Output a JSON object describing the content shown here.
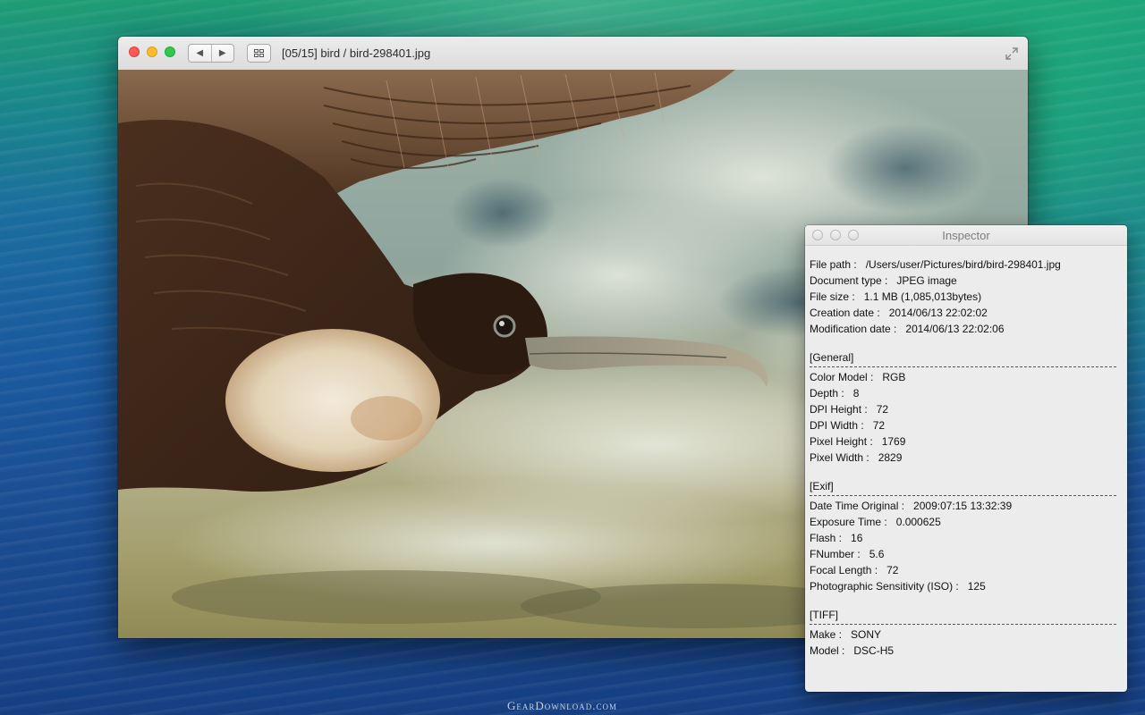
{
  "desktop": {
    "watermark": "GearDownload.com",
    "colors": {
      "wave_top": "#1f9d74",
      "wave_bottom": "#163f82"
    }
  },
  "viewer": {
    "title": "[05/15] bird / bird-298401.jpg",
    "nav": {
      "back_icon": "triangle-left-icon",
      "back_glyph": "◀",
      "forward_icon": "triangle-right-icon",
      "forward_glyph": "▶"
    },
    "grid_icon": "thumbnail-grid-icon",
    "fullscreen_icon": "fullscreen-expand-icon",
    "image_subject": "bird"
  },
  "inspector": {
    "title": "Inspector",
    "file": [
      {
        "key": "File path :",
        "value": "/Users/user/Pictures/bird/bird-298401.jpg"
      },
      {
        "key": "Document type :",
        "value": "JPEG image"
      },
      {
        "key": "File size :",
        "value": "1.1 MB (1,085,013bytes)"
      },
      {
        "key": "Creation date :",
        "value": "2014/06/13 22:02:02"
      },
      {
        "key": "Modification date :",
        "value": "2014/06/13 22:02:06"
      }
    ],
    "general": {
      "header": "[General]",
      "rows": [
        {
          "key": "Color Model :",
          "value": "RGB"
        },
        {
          "key": "Depth :",
          "value": "8"
        },
        {
          "key": "DPI Height :",
          "value": "72"
        },
        {
          "key": "DPI Width :",
          "value": "72"
        },
        {
          "key": "Pixel Height :",
          "value": "1769"
        },
        {
          "key": "Pixel Width :",
          "value": "2829"
        }
      ]
    },
    "exif": {
      "header": "[Exif]",
      "rows": [
        {
          "key": "Date Time Original :",
          "value": "2009:07:15 13:32:39"
        },
        {
          "key": "Exposure Time :",
          "value": "0.000625"
        },
        {
          "key": "Flash :",
          "value": "16"
        },
        {
          "key": "FNumber :",
          "value": "5.6"
        },
        {
          "key": "Focal Length :",
          "value": "72"
        },
        {
          "key": "Photographic Sensitivity (ISO) :",
          "value": "125"
        }
      ]
    },
    "tiff": {
      "header": "[TIFF]",
      "rows": [
        {
          "key": "Make :",
          "value": "SONY"
        },
        {
          "key": "Model :",
          "value": "DSC-H5"
        }
      ]
    }
  }
}
